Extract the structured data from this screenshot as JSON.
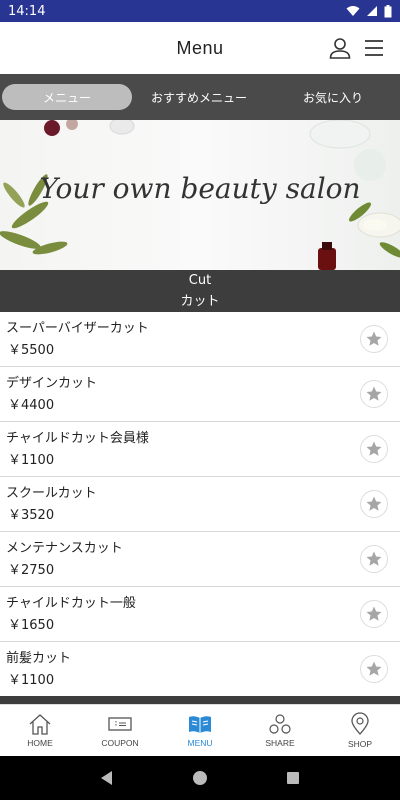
{
  "status_bar": {
    "time": "14:14"
  },
  "header": {
    "title": "Menu"
  },
  "tabs": [
    {
      "label": "メニュー",
      "active": true
    },
    {
      "label": "おすすめメニュー",
      "active": false
    },
    {
      "label": "お気に入り",
      "active": false
    }
  ],
  "banner": {
    "text": "Your own beauty salon"
  },
  "category": {
    "title_en": "Cut",
    "title_ja": "カット"
  },
  "items": [
    {
      "name": "スーパーバイザーカット",
      "price": "￥5500"
    },
    {
      "name": "デザインカット",
      "price": "￥4400"
    },
    {
      "name": "チャイルドカット会員様",
      "price": "￥1100"
    },
    {
      "name": "スクールカット",
      "price": "￥3520"
    },
    {
      "name": "メンテナンスカット",
      "price": "￥2750"
    },
    {
      "name": "チャイルドカット一般",
      "price": "￥1650"
    },
    {
      "name": "前髪カット",
      "price": "￥1100"
    }
  ],
  "bottom_nav": [
    {
      "label": "HOME",
      "icon": "home-icon",
      "active": false
    },
    {
      "label": "COUPON",
      "icon": "coupon-icon",
      "active": false
    },
    {
      "label": "MENU",
      "icon": "book-icon",
      "active": true
    },
    {
      "label": "SHARE",
      "icon": "share-icon",
      "active": false
    },
    {
      "label": "SHOP",
      "icon": "location-pin-icon",
      "active": false
    }
  ],
  "colors": {
    "status_bar": "#283593",
    "tab_bar": "#4a4a4a",
    "accent": "#2b8ad6"
  }
}
